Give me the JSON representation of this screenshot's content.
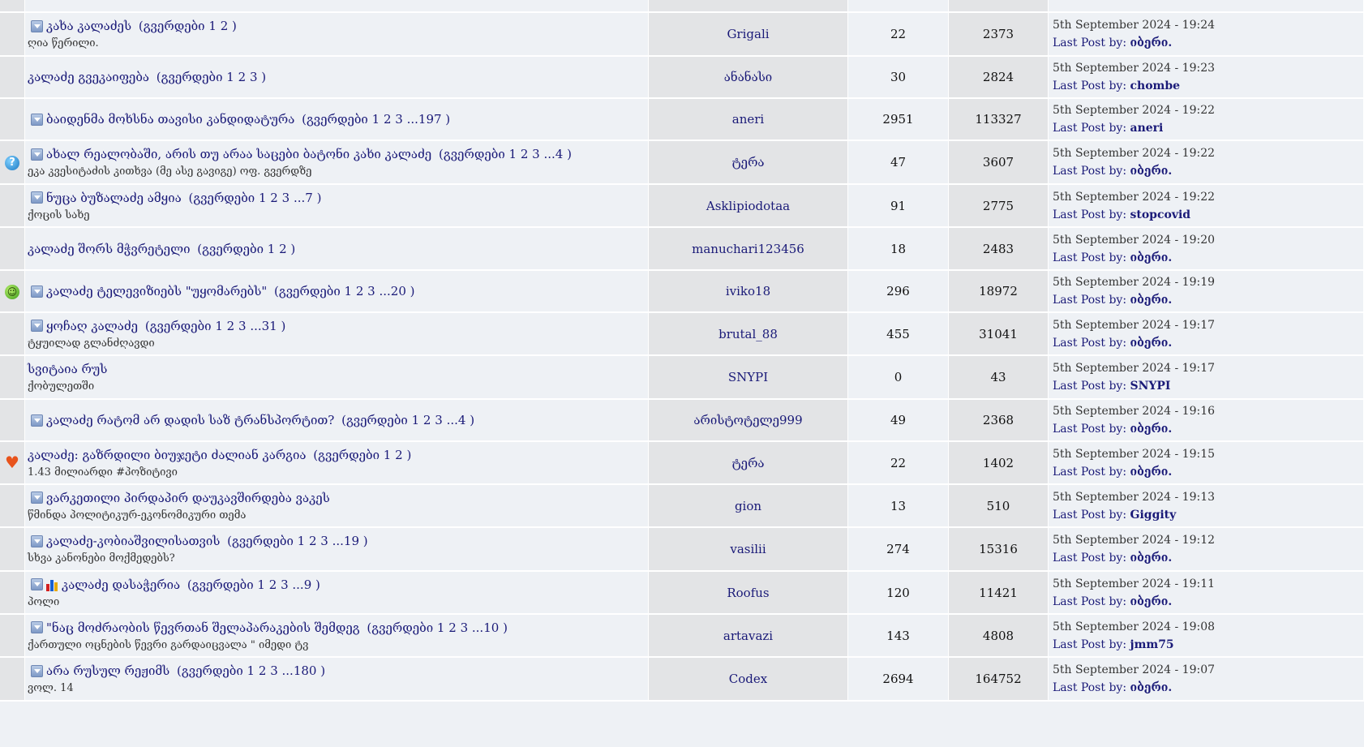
{
  "colors": {
    "link": "#1a1a78",
    "row_light": "#eef1f5",
    "row_dark": "#e3e4e6"
  },
  "pages_label": "გვერდები",
  "last_post_label": "Last Post by:",
  "topics": [
    {
      "icon": "none",
      "has_attach": false,
      "has_poll": false,
      "title": "",
      "pages": [],
      "desc": "",
      "author": "",
      "replies": "",
      "views": "",
      "date": "",
      "last_by": ""
    },
    {
      "icon": "none",
      "has_attach": true,
      "has_poll": false,
      "title": "კახა კალაძეს",
      "pages": [
        "1",
        "2"
      ],
      "desc": "ღია წერილი.",
      "author": "Grigali",
      "replies": "22",
      "views": "2373",
      "date": "5th September 2024 - 19:24",
      "last_by": " იბერი."
    },
    {
      "icon": "none",
      "has_attach": false,
      "has_poll": false,
      "title": "კალაძე გვეკაიფება",
      "pages": [
        "1",
        "2",
        "3"
      ],
      "desc": "",
      "author": "ანანასი",
      "replies": "30",
      "views": "2824",
      "date": "5th September 2024 - 19:23",
      "last_by": "chombe"
    },
    {
      "icon": "none",
      "has_attach": true,
      "has_poll": false,
      "title": "ბაიდენმა მოხსნა თავისი კანდიდატურა",
      "pages": [
        "1",
        "2",
        "3",
        "...197"
      ],
      "desc": "",
      "author": "aneri",
      "replies": "2951",
      "views": "113327",
      "date": "5th September 2024 - 19:22",
      "last_by": "aneri"
    },
    {
      "icon": "question",
      "has_attach": true,
      "has_poll": false,
      "title": "ახალ რეალობაში, არის თუ არაა საცები ბატონი კახი კალაძე",
      "pages": [
        "1",
        "2",
        "3",
        "...4"
      ],
      "desc": "ეკა კვესიტაძის კითხვა (მე ასე გავიგე) ოფ. გვერდზე",
      "author": "ტერა",
      "replies": "47",
      "views": "3607",
      "date": "5th September 2024 - 19:22",
      "last_by": "იბერი."
    },
    {
      "icon": "none",
      "has_attach": true,
      "has_poll": false,
      "title": "ნუცა ბუზალაძე ამყია",
      "pages": [
        "1",
        "2",
        "3",
        "...7"
      ],
      "desc": "ქოცის სახე",
      "author": "Asklipiodotaa",
      "replies": "91",
      "views": "2775",
      "date": "5th September 2024 - 19:22",
      "last_by": "stopcovid"
    },
    {
      "icon": "none",
      "has_attach": false,
      "has_poll": false,
      "title": "კალაძე შორს მჭვრეტელი",
      "pages": [
        "1",
        "2"
      ],
      "desc": "",
      "author": "manuchari123456",
      "replies": "18",
      "views": "2483",
      "date": "5th September 2024 - 19:20",
      "last_by": "იბერი."
    },
    {
      "icon": "grin",
      "has_attach": true,
      "has_poll": false,
      "title": "კალაძე ტელევიზიებს \"უყომარებს\"",
      "pages": [
        "1",
        "2",
        "3",
        "...20"
      ],
      "desc": "",
      "author": "iviko18",
      "replies": "296",
      "views": "18972",
      "date": "5th September 2024 - 19:19",
      "last_by": "იბერი."
    },
    {
      "icon": "none",
      "has_attach": true,
      "has_poll": false,
      "title": "ყოჩაღ კალაძე",
      "pages": [
        "1",
        "2",
        "3",
        "...31"
      ],
      "desc": "ტყუილად გლანძღავდი",
      "author": "brutal_88",
      "replies": "455",
      "views": "31041",
      "date": "5th September 2024 - 19:17",
      "last_by": "იბერი."
    },
    {
      "icon": "none",
      "has_attach": false,
      "has_poll": false,
      "title": "სვიტაია რუს",
      "pages": [],
      "desc": "ქობულეთში",
      "author": "SNYPI",
      "replies": "0",
      "views": "43",
      "date": "5th September 2024 - 19:17",
      "last_by": "SNYPI"
    },
    {
      "icon": "none",
      "has_attach": true,
      "has_poll": false,
      "title": "კალაძე რატომ არ დადის საზ ტრანსპორტით?",
      "pages": [
        "1",
        "2",
        "3",
        "...4"
      ],
      "desc": "",
      "author": "არისტოტელე999",
      "replies": "49",
      "views": "2368",
      "date": "5th September 2024 - 19:16",
      "last_by": "იბერი."
    },
    {
      "icon": "heart",
      "has_attach": false,
      "has_poll": false,
      "title": "კალაძე: გაზრდილი ბიუჯეტი ძალიან კარგია",
      "pages": [
        "1",
        "2"
      ],
      "desc": "1.43 მილიარდი #პოზიტივი",
      "author": "ტერა",
      "replies": "22",
      "views": "1402",
      "date": "5th September 2024 - 19:15",
      "last_by": "იბერი."
    },
    {
      "icon": "none",
      "has_attach": true,
      "has_poll": false,
      "title": "ვარკეთილი პირდაპირ დაუკავშირდება ვაკეს",
      "pages": [],
      "desc": "წმინდა პოლიტიკურ-ეკონომიკური თემა",
      "author": "gion",
      "replies": "13",
      "views": "510",
      "date": "5th September 2024 - 19:13",
      "last_by": "Giggity"
    },
    {
      "icon": "none",
      "has_attach": true,
      "has_poll": false,
      "title": "კალაძე-კობიაშვილისათვის",
      "pages": [
        "1",
        "2",
        "3",
        "...19"
      ],
      "desc": "სხვა კანონები მოქმედებს?",
      "author": "vasilii",
      "replies": "274",
      "views": "15316",
      "date": "5th September 2024 - 19:12",
      "last_by": "იბერი."
    },
    {
      "icon": "none",
      "has_attach": true,
      "has_poll": true,
      "title": "კალაძე დასაჭერია",
      "pages": [
        "1",
        "2",
        "3",
        "...9"
      ],
      "desc": "პოლი",
      "author": "Roofus",
      "replies": "120",
      "views": "11421",
      "date": "5th September 2024 - 19:11",
      "last_by": "იბერი."
    },
    {
      "icon": "none",
      "has_attach": true,
      "has_poll": false,
      "title": "\"ნაც მოძრაობის წევრთან შელაპარაკების შემდეგ",
      "pages": [
        "1",
        "2",
        "3",
        "...10"
      ],
      "desc": "ქართული ოცნების წევრი გარდაიცვალა \" იმედი ტვ",
      "author": "artavazi",
      "replies": "143",
      "views": "4808",
      "date": "5th September 2024 - 19:08",
      "last_by": "jmm75"
    },
    {
      "icon": "none",
      "has_attach": true,
      "has_poll": false,
      "title": "არა რუსულ რეჟიმს",
      "pages": [
        "1",
        "2",
        "3",
        "...180"
      ],
      "desc": "ვოლ. 14",
      "author": "Codex",
      "replies": "2694",
      "views": "164752",
      "date": "5th September 2024 - 19:07",
      "last_by": "იბერი."
    }
  ]
}
